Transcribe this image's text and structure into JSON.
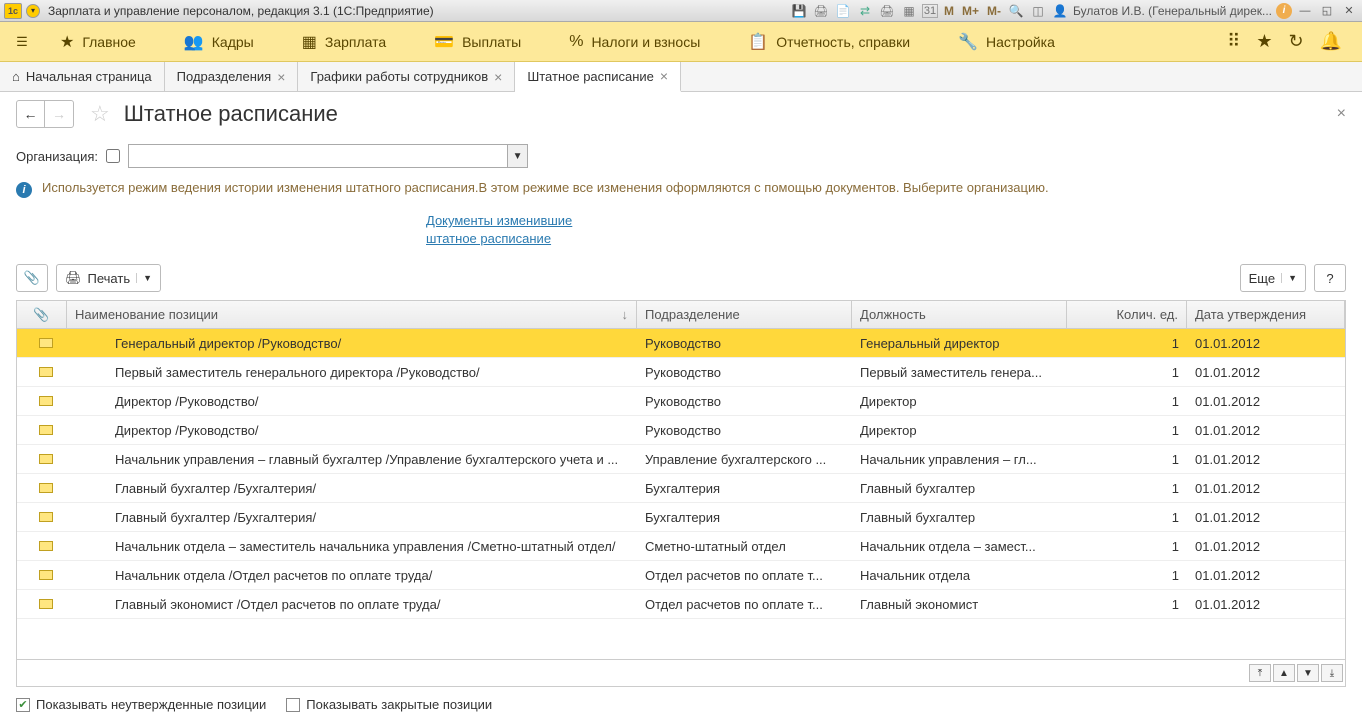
{
  "titlebar": {
    "app_title": "Зарплата и управление персоналом, редакция 3.1  (1С:Предприятие)",
    "user": "Булатов И.В. (Генеральный дирек...",
    "m_labels": [
      "M",
      "M+",
      "M-"
    ]
  },
  "main_menu": {
    "items": [
      {
        "icon": "menu",
        "label": ""
      },
      {
        "icon": "★",
        "label": "Главное"
      },
      {
        "icon": "👥",
        "label": "Кадры"
      },
      {
        "icon": "▦",
        "label": "Зарплата"
      },
      {
        "icon": "💰",
        "label": "Выплаты"
      },
      {
        "icon": "%",
        "label": "Налоги и взносы"
      },
      {
        "icon": "📋",
        "label": "Отчетность, справки"
      },
      {
        "icon": "🔧",
        "label": "Настройка"
      }
    ]
  },
  "tabs": [
    {
      "label": "Начальная страница",
      "has_home": true,
      "closable": false,
      "active": false
    },
    {
      "label": "Подразделения",
      "closable": true,
      "active": false
    },
    {
      "label": "Графики работы сотрудников",
      "closable": true,
      "active": false
    },
    {
      "label": "Штатное расписание",
      "closable": true,
      "active": true
    }
  ],
  "page": {
    "title": "Штатное расписание",
    "org_label": "Организация:",
    "info_text": "Используется режим ведения истории изменения штатного расписания.В этом режиме все изменения оформляются с помощью документов. Выберите организацию.",
    "link1": "Документы изменившие",
    "link2": "штатное расписание",
    "print_label": "Печать",
    "more_label": "Еще",
    "help_label": "?",
    "show_unapproved": "Показывать неутвержденные позиции",
    "show_closed": "Показывать закрытые позиции"
  },
  "table": {
    "columns": {
      "name": "Наименование позиции",
      "dept": "Подразделение",
      "pos": "Должность",
      "qty": "Колич. ед.",
      "date": "Дата утверждения"
    },
    "rows": [
      {
        "name": "Генеральный директор /Руководство/",
        "dept": "Руководство",
        "pos": "Генеральный директор",
        "qty": "1",
        "date": "01.01.2012",
        "selected": true
      },
      {
        "name": "Первый заместитель генерального директора /Руководство/",
        "dept": "Руководство",
        "pos": "Первый заместитель генера...",
        "qty": "1",
        "date": "01.01.2012"
      },
      {
        "name": "Директор /Руководство/",
        "dept": "Руководство",
        "pos": "Директор",
        "qty": "1",
        "date": "01.01.2012"
      },
      {
        "name": "Директор /Руководство/",
        "dept": "Руководство",
        "pos": "Директор",
        "qty": "1",
        "date": "01.01.2012"
      },
      {
        "name": "Начальник управления – главный бухгалтер /Управление бухгалтерского учета и ...",
        "dept": "Управление бухгалтерского ...",
        "pos": "Начальник управления – гл...",
        "qty": "1",
        "date": "01.01.2012"
      },
      {
        "name": "Главный бухгалтер /Бухгалтерия/",
        "dept": "Бухгалтерия",
        "pos": "Главный бухгалтер",
        "qty": "1",
        "date": "01.01.2012"
      },
      {
        "name": "Главный бухгалтер /Бухгалтерия/",
        "dept": "Бухгалтерия",
        "pos": "Главный бухгалтер",
        "qty": "1",
        "date": "01.01.2012"
      },
      {
        "name": "Начальник отдела – заместитель начальника управления /Сметно-штатный отдел/",
        "dept": "Сметно-штатный отдел",
        "pos": "Начальник отдела – замест...",
        "qty": "1",
        "date": "01.01.2012"
      },
      {
        "name": "Начальник отдела /Отдел расчетов по оплате труда/",
        "dept": "Отдел расчетов по оплате т...",
        "pos": "Начальник отдела",
        "qty": "1",
        "date": "01.01.2012"
      },
      {
        "name": "Главный экономист /Отдел расчетов по оплате труда/",
        "dept": "Отдел расчетов по оплате т...",
        "pos": "Главный экономист",
        "qty": "1",
        "date": "01.01.2012"
      }
    ]
  }
}
